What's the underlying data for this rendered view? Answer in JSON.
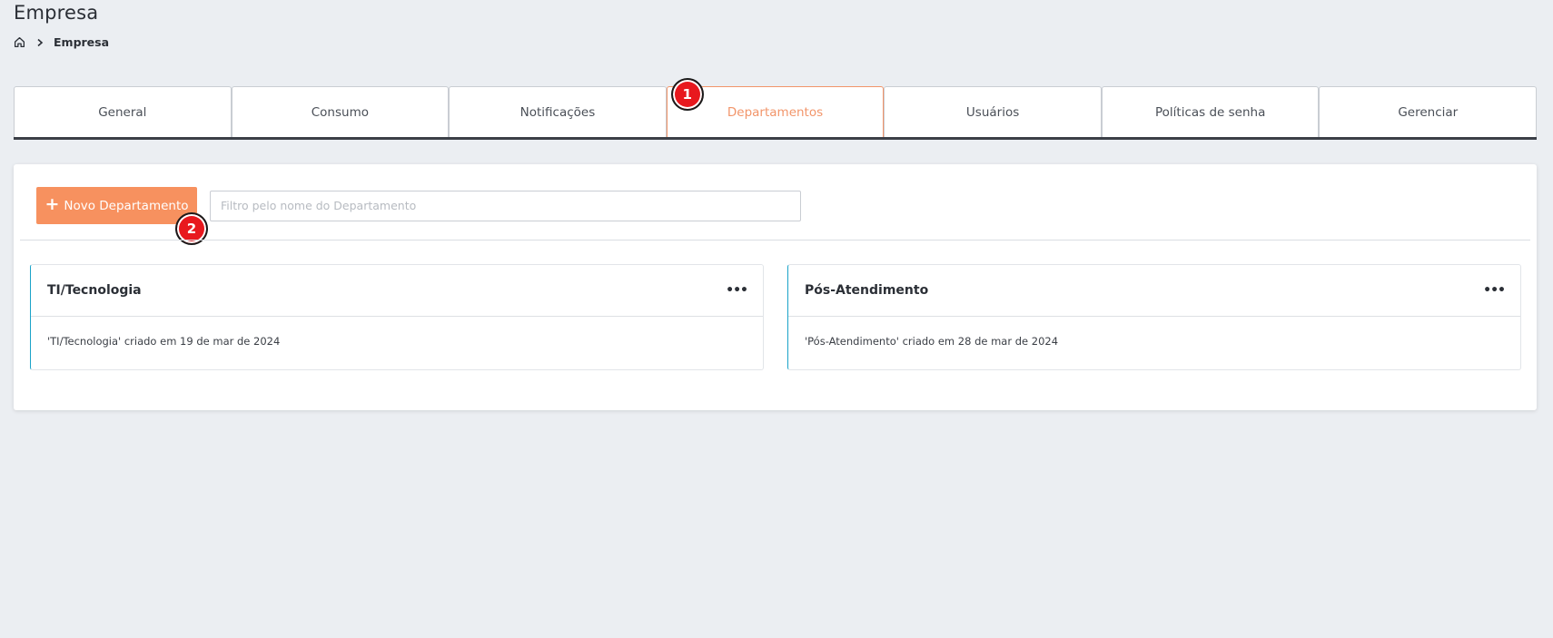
{
  "page": {
    "title": "Empresa"
  },
  "breadcrumb": {
    "home_icon": "home-icon",
    "separator_icon": "chevron-right-icon",
    "current": "Empresa"
  },
  "tabs": [
    {
      "label": "General",
      "active": false
    },
    {
      "label": "Consumo",
      "active": false
    },
    {
      "label": "Notificações",
      "active": false
    },
    {
      "label": "Departamentos",
      "active": true,
      "badge": "1"
    },
    {
      "label": "Usuários",
      "active": false
    },
    {
      "label": "Políticas de senha",
      "active": false
    },
    {
      "label": "Gerenciar",
      "active": false
    }
  ],
  "toolbar": {
    "new_button_label": "Novo Departamento",
    "new_button_badge": "2",
    "filter_placeholder": "Filtro pelo nome do Departamento",
    "filter_value": ""
  },
  "departments": [
    {
      "name": "TI/Tecnologia",
      "menu": "•••",
      "description": "'TI/Tecnologia' criado em 19 de mar de 2024"
    },
    {
      "name": "Pós-Atendimento",
      "menu": "•••",
      "description": "'Pós-Atendimento' criado em 28 de mar de 2024"
    }
  ],
  "colors": {
    "accent": "#f7915f",
    "active_tab": "#f2956a",
    "badge": "#e8181e",
    "card_accent": "#1aa3c9",
    "background": "#ebeef2"
  }
}
